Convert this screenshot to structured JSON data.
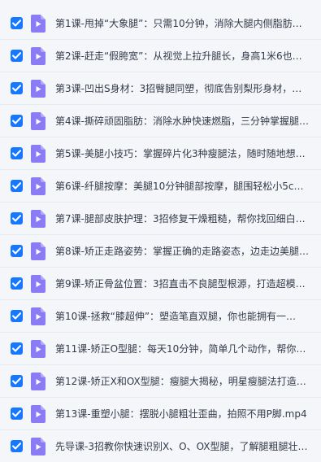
{
  "colors": {
    "checkbox": "#1677ff",
    "video_icon": "#8b7cf6",
    "text": "#333a48",
    "background": "#f4f6fa"
  },
  "files": [
    {
      "checked": true,
      "icon": "video-file-icon",
      "name": "第1课-甩掉“大象腿”：只需10分钟，消除大腿内侧脂肪…"
    },
    {
      "checked": true,
      "icon": "video-file-icon",
      "name": "第2课-赶走“假胯宽”：从视觉上拉升腿长，身高1米6也…"
    },
    {
      "checked": true,
      "icon": "video-file-icon",
      "name": "第3课-凹出S身材：3招臀腿同塑，彻底告别梨形身材，打…"
    },
    {
      "checked": true,
      "icon": "video-file-icon",
      "name": "第4课-撕碎顽固脂肪：消除水肿快速燃脂，三分钟掌握腿…"
    },
    {
      "checked": true,
      "icon": "video-file-icon",
      "name": "第5课-美腿小技巧：掌握碎片化3种瘦腿法，随时随地想…"
    },
    {
      "checked": true,
      "icon": "video-file-icon",
      "name": "第6课-纤腿按摩：美腿10分钟腿部按摩，腿围轻松小5cm…"
    },
    {
      "checked": true,
      "icon": "video-file-icon",
      "name": "第7课-腿部皮肤护理：3招修复干燥粗糙，帮你找回细白…"
    },
    {
      "checked": true,
      "icon": "video-file-icon",
      "name": "第8课-矫正走路姿势：掌握正确的走路姿态，边走边美腿…"
    },
    {
      "checked": true,
      "icon": "video-file-icon",
      "name": "第9课-矫正骨盆位置：3招直击不良腿型根源，打造超模…"
    },
    {
      "checked": true,
      "icon": "video-file-icon",
      "name": "第10课-拯救“膝超伸”：塑造笔直双腿，你也能拥有一…"
    },
    {
      "checked": true,
      "icon": "video-file-icon",
      "name": "第11课-矫正O型腿：每天10分钟，简单几个动作，帮你…"
    },
    {
      "checked": true,
      "icon": "video-file-icon",
      "name": "第12课-矫正X和OX型腿：瘦腿大揭秘，明星瘦腿法打造…"
    },
    {
      "checked": true,
      "icon": "video-file-icon",
      "name": "第13课-重塑小腿：摆脱小腿粗壮歪曲，拍照不用P脚.mp4"
    },
    {
      "checked": true,
      "icon": "video-file-icon",
      "name": "先导课-3招教你快速识别X、O、OX型腿，了解腿粗腿壮…"
    }
  ]
}
